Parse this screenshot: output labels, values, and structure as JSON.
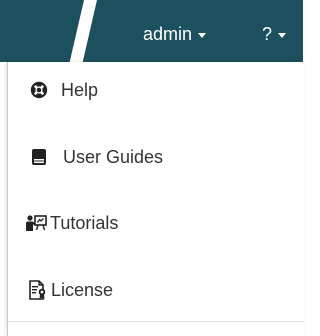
{
  "colors": {
    "topbar": "#1c505f",
    "menu_text": "#333333",
    "icon": "#222222"
  },
  "navbar": {
    "user_menu_label": "admin",
    "help_menu_label": "?"
  },
  "help_menu": {
    "items": [
      {
        "label": "Help",
        "icon": "life-ring-icon"
      },
      {
        "label": "User Guides",
        "icon": "book-icon"
      },
      {
        "label": "Tutorials",
        "icon": "presenter-icon"
      },
      {
        "label": "License",
        "icon": "license-document-icon"
      }
    ]
  }
}
